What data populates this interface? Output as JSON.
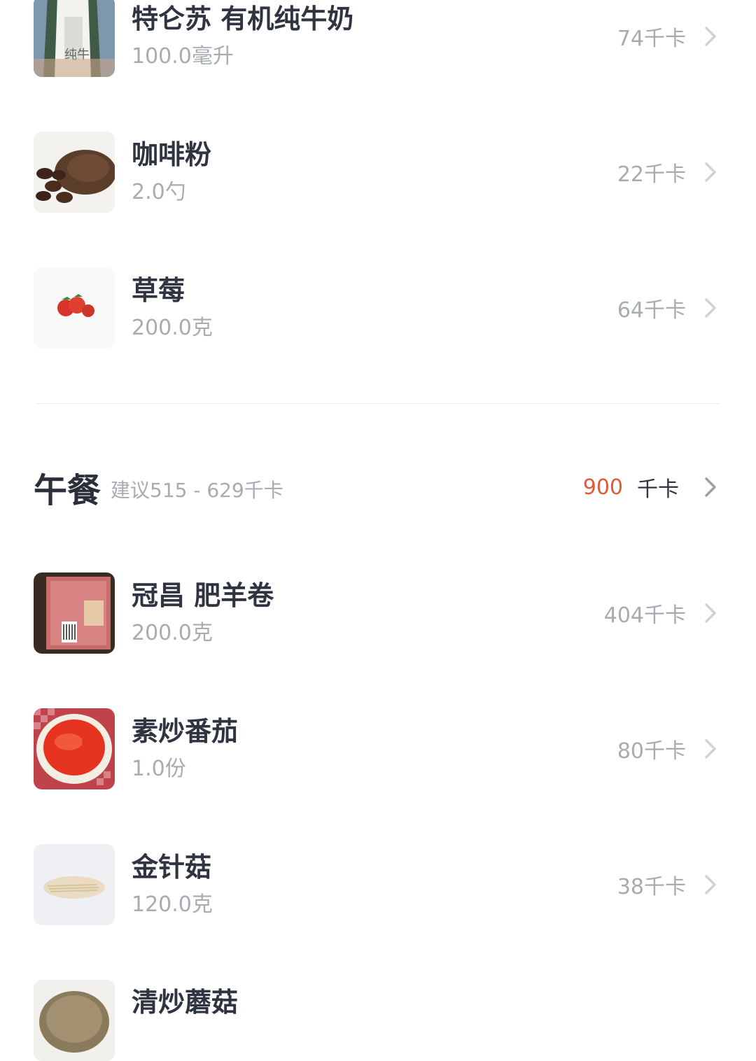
{
  "breakfast_items": [
    {
      "name": "特仑苏 有机纯牛奶",
      "amount": "100.0毫升",
      "kcal": "74千卡",
      "icon": "milk-carton-photo"
    },
    {
      "name": "咖啡粉",
      "amount": "2.0勺",
      "kcal": "22千卡",
      "icon": "coffee-powder-photo"
    },
    {
      "name": "草莓",
      "amount": "200.0克",
      "kcal": "64千卡",
      "icon": "strawberry-photo"
    }
  ],
  "lunch": {
    "title": "午餐",
    "suggestion": "建议515 - 629千卡",
    "total": "900",
    "unit": "千卡",
    "total_color": "#e05a3a"
  },
  "lunch_items": [
    {
      "name": "冠昌 肥羊卷",
      "amount": "200.0克",
      "kcal": "404千卡",
      "icon": "lamb-roll-photo"
    },
    {
      "name": "素炒番茄",
      "amount": "1.0份",
      "kcal": "80千卡",
      "icon": "fried-tomato-photo"
    },
    {
      "name": "金针菇",
      "amount": "120.0克",
      "kcal": "38千卡",
      "icon": "enoki-mushroom-photo"
    },
    {
      "name": "清炒蘑菇",
      "amount": "",
      "kcal": "",
      "icon": "fried-mushroom-photo"
    }
  ]
}
